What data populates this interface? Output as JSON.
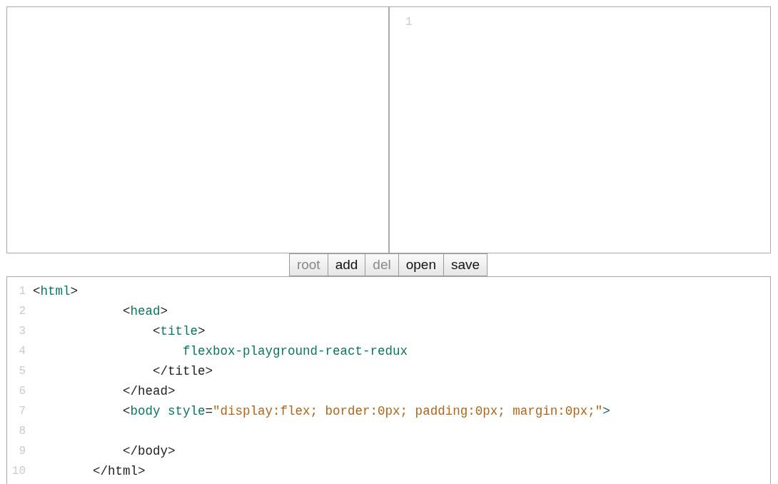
{
  "source_pane": {
    "lines": [
      {
        "number": "1"
      }
    ]
  },
  "toolbar": {
    "buttons": [
      {
        "label": "root",
        "disabled": true
      },
      {
        "label": "add",
        "disabled": false
      },
      {
        "label": "del",
        "disabled": true
      },
      {
        "label": "open",
        "disabled": false
      },
      {
        "label": "save",
        "disabled": false
      }
    ]
  },
  "code_editor": {
    "lines": [
      {
        "number": "1",
        "tokens": [
          {
            "kind": "punct",
            "text": "<"
          },
          {
            "kind": "tag",
            "text": "html"
          },
          {
            "kind": "punct",
            "text": ">"
          }
        ]
      },
      {
        "number": "2",
        "tokens": [
          {
            "kind": "punct",
            "text": "            <"
          },
          {
            "kind": "tag",
            "text": "head"
          },
          {
            "kind": "punct",
            "text": ">"
          }
        ]
      },
      {
        "number": "3",
        "tokens": [
          {
            "kind": "punct",
            "text": "                <"
          },
          {
            "kind": "tag",
            "text": "title"
          },
          {
            "kind": "punct",
            "text": ">"
          }
        ]
      },
      {
        "number": "4",
        "tokens": [
          {
            "kind": "tag",
            "text": "                    flexbox-playground-react-redux"
          }
        ]
      },
      {
        "number": "5",
        "tokens": [
          {
            "kind": "punct",
            "text": "                </title>"
          }
        ]
      },
      {
        "number": "6",
        "tokens": [
          {
            "kind": "punct",
            "text": "            </head>"
          }
        ]
      },
      {
        "number": "7",
        "tokens": [
          {
            "kind": "punct",
            "text": "            <"
          },
          {
            "kind": "tag",
            "text": "body"
          },
          {
            "kind": "attr",
            "text": " style"
          },
          {
            "kind": "punct",
            "text": "="
          },
          {
            "kind": "string",
            "text": "\"display:flex; border:0px; padding:0px; margin:0px;\""
          },
          {
            "kind": "bracket",
            "text": ">"
          }
        ]
      },
      {
        "number": "8"
      },
      {
        "number": "9",
        "tokens": [
          {
            "kind": "punct",
            "text": "            </body>"
          }
        ]
      },
      {
        "number": "10",
        "tokens": [
          {
            "kind": "punct",
            "text": "        </html>"
          }
        ]
      }
    ]
  }
}
